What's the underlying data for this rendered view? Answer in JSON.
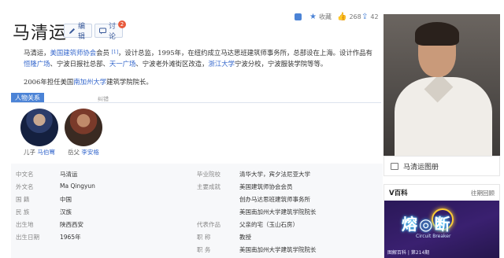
{
  "title": "马清运",
  "toolbar": {
    "edit_label": "编辑",
    "discuss_label": "讨论",
    "discuss_badge": "2"
  },
  "topbar": {
    "favorite_label": "收藏",
    "like_count": "268",
    "share_count": "42"
  },
  "intro": {
    "seg1": "马清运，",
    "link1": "美国建筑师协会",
    "seg2": "会员",
    "ref": "[1]",
    "seg3": "，设计总监，1995年，在纽约成立马达思班建筑师事务所，总部设在上海。设计作品有",
    "link2": "恒隆广场",
    "seg4": "、宁波日报社总部、",
    "link3": "天一广场",
    "seg5": "、宁波老外滩街区改造，",
    "link4": "浙江大学",
    "seg6": "宁波分校，宁波服装学院等等。"
  },
  "para2": {
    "seg1": "2006年担任美国",
    "link": "南加州大学",
    "seg2": "建筑学院院长。"
  },
  "relations": {
    "tab_label": "人物关系",
    "error_label": "纠错",
    "people": [
      {
        "relation": "儿子",
        "name": "马伯骞"
      },
      {
        "relation": "岳父",
        "name": "李安格"
      }
    ]
  },
  "info": {
    "rows": [
      {
        "k1": "中文名",
        "v1": "马清运",
        "k2": "毕业院校",
        "v2": "清华大学，宾夕法尼亚大学"
      },
      {
        "k1": "外文名",
        "v1": "Ma Qingyun",
        "k2": "主要成就",
        "v2": "美国建筑师协会会员"
      },
      {
        "k1": "国    籍",
        "v1": "中国",
        "k2": "",
        "v2": "创办马达思班建筑师事务所"
      },
      {
        "k1": "民    族",
        "v1": "汉族",
        "k2": "",
        "v2": "美国南加州大学建筑学院院长"
      },
      {
        "k1": "出生地",
        "v1": "陕西西安",
        "k2": "代表作品",
        "v2": "父亲的宅（玉山石房）"
      },
      {
        "k1": "出生日期",
        "v1": "1965年",
        "k2": "职    称",
        "v2": "教授"
      },
      {
        "k1": "",
        "v1": "",
        "k2": "职    务",
        "v2": "美国南加州大学建筑学院院长"
      }
    ]
  },
  "sidebar": {
    "gallery_label": "马清运图册",
    "vbaike_title": "V百科",
    "vbaike_more": "往期回顾",
    "banner_big": "熔◎断",
    "banner_sub": "Circuit Breaker",
    "banner_foot": "图解百科 | 第214期"
  }
}
